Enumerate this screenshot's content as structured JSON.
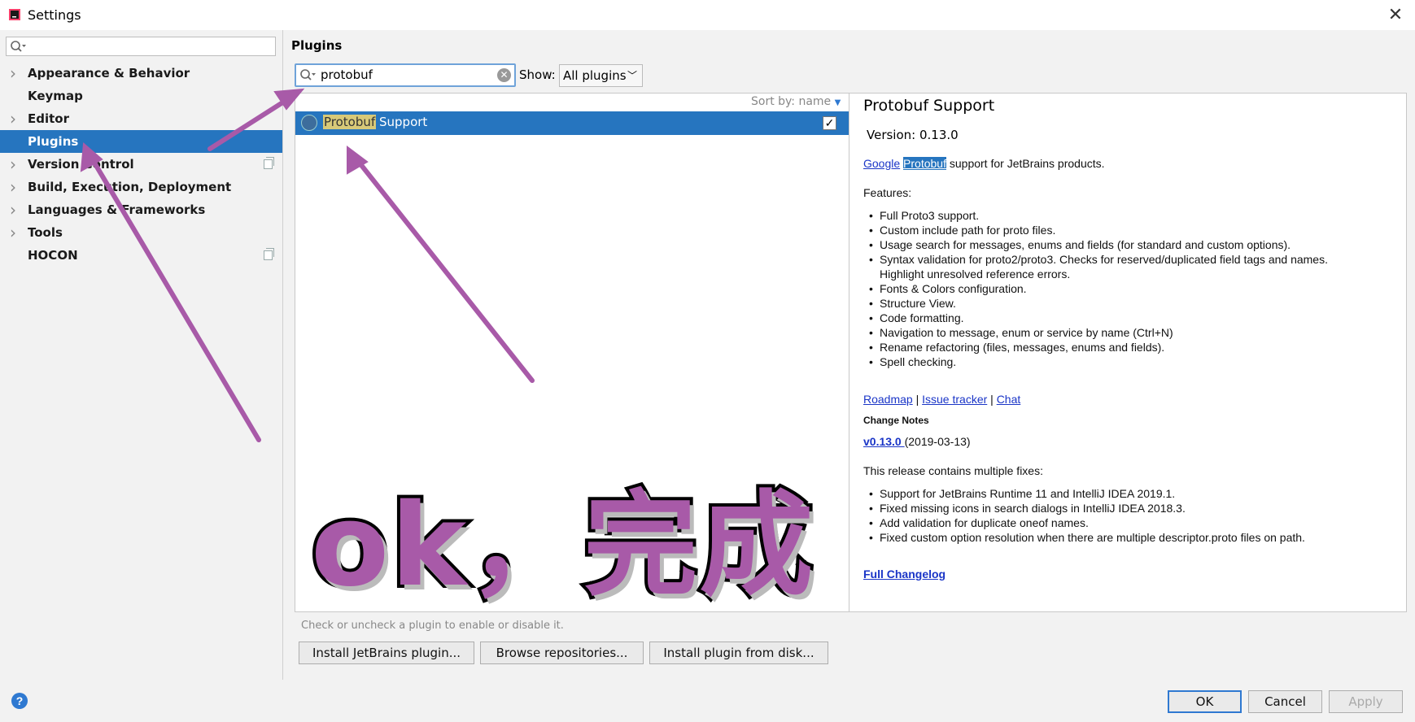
{
  "window": {
    "title": "Settings"
  },
  "sidebar": {
    "search_value": "",
    "items": [
      {
        "label": "Appearance & Behavior",
        "expandable": true,
        "selected": false
      },
      {
        "label": "Keymap",
        "expandable": false,
        "selected": false
      },
      {
        "label": "Editor",
        "expandable": true,
        "selected": false
      },
      {
        "label": "Plugins",
        "expandable": false,
        "selected": true
      },
      {
        "label": "Version Control",
        "expandable": true,
        "selected": false,
        "project_icon": true
      },
      {
        "label": "Build, Execution, Deployment",
        "expandable": true,
        "selected": false
      },
      {
        "label": "Languages & Frameworks",
        "expandable": true,
        "selected": false
      },
      {
        "label": "Tools",
        "expandable": true,
        "selected": false
      },
      {
        "label": "HOCON",
        "expandable": false,
        "selected": false,
        "project_icon": true
      }
    ]
  },
  "main": {
    "title": "Plugins",
    "search_value": "protobuf",
    "show_label": "Show:",
    "show_value": "All plugins",
    "sort_label": "Sort by: name",
    "plugin": {
      "name_highlight": "Protobuf",
      "name_rest": " Support",
      "enabled": true
    },
    "hint": "Check or uncheck a plugin to enable or disable it.",
    "buttons": {
      "install_jetbrains": "Install JetBrains plugin...",
      "browse": "Browse repositories...",
      "install_disk": "Install plugin from disk..."
    }
  },
  "detail": {
    "title": "Protobuf Support",
    "version": "Version: 0.13.0",
    "desc_link1": "Google",
    "desc_link2": "Protobuf",
    "desc_rest": " support for JetBrains products.",
    "features_label": "Features:",
    "features": [
      "Full Proto3 support.",
      "Custom include path for proto files.",
      "Usage search for messages, enums and fields (for standard and custom options).",
      "Syntax validation for proto2/proto3. Checks for reserved/duplicated field tags and names.",
      "Highlight unresolved reference errors.",
      "Fonts & Colors configuration.",
      "Structure View.",
      "Code formatting.",
      "Navigation to message, enum or service by name (Ctrl+N)",
      "Rename refactoring (files, messages, enums and fields).",
      "Spell checking."
    ],
    "links": {
      "roadmap": "Roadmap",
      "sep": " | ",
      "issue": "Issue tracker",
      "chat": "Chat"
    },
    "change_notes_label": "Change Notes",
    "release_link": "v0.13.0 ",
    "release_date": "(2019-03-13)",
    "release_intro": "This release contains multiple fixes:",
    "fixes": [
      "Support for JetBrains Runtime 11 and IntelliJ IDEA 2019.1.",
      "Fixed missing icons in search dialogs in IntelliJ IDEA 2018.3.",
      "Add validation for duplicate oneof names.",
      "Fixed custom option resolution when there are multiple descriptor.proto files on path."
    ],
    "full_changelog": "Full Changelog "
  },
  "footer": {
    "ok": "OK",
    "cancel": "Cancel",
    "apply": "Apply",
    "help": "?"
  },
  "annotation": {
    "text": "ok，完成",
    "color": "#a85aa8"
  }
}
